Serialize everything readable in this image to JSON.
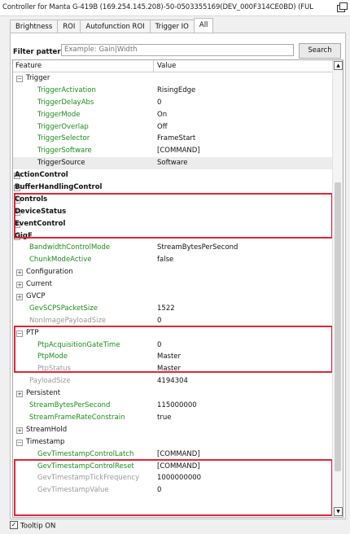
{
  "window": {
    "title": "Controller for Manta G-419B (169.254.145.208)-50-0503355169(DEV_000F314CE0BD) (FUL"
  },
  "tabs": [
    "Brightness",
    "ROI",
    "Autofunction ROI",
    "Trigger IO",
    "All"
  ],
  "filter": {
    "label": "Filter pattern:",
    "placeholder": "Example: Gain|Width",
    "search_label": "Search"
  },
  "table": {
    "col_feature": "Feature",
    "col_value": "Value"
  },
  "rows": [
    {
      "name": "Trigger",
      "value": "",
      "style": "",
      "exp": "-",
      "indent": 16
    },
    {
      "name": "TriggerActivation",
      "value": "RisingEdge",
      "style": "green",
      "indent": 30
    },
    {
      "name": "TriggerDelayAbs",
      "value": "0",
      "style": "green",
      "indent": 30
    },
    {
      "name": "TriggerMode",
      "value": "On",
      "style": "green",
      "indent": 30
    },
    {
      "name": "TriggerOverlap",
      "value": "Off",
      "style": "green",
      "indent": 30
    },
    {
      "name": "TriggerSelector",
      "value": "FrameStart",
      "style": "green",
      "indent": 30
    },
    {
      "name": "TriggerSoftware",
      "value": "[COMMAND]",
      "style": "green",
      "indent": 30
    },
    {
      "name": "TriggerSource",
      "value": "Software",
      "style": "",
      "indent": 30,
      "sel": true
    },
    {
      "name": "ActionControl",
      "value": "",
      "style": "bold",
      "exp": "+",
      "indent": 2
    },
    {
      "name": "BufferHandlingControl",
      "value": "",
      "style": "bold",
      "exp": "+",
      "indent": 2
    },
    {
      "name": "Controls",
      "value": "",
      "style": "bold",
      "exp": "+",
      "indent": 2
    },
    {
      "name": "DeviceStatus",
      "value": "",
      "style": "bold",
      "exp": "+",
      "indent": 2
    },
    {
      "name": "EventControl",
      "value": "",
      "style": "bold",
      "exp": "+",
      "indent": 2
    },
    {
      "name": "GigE",
      "value": "",
      "style": "bold",
      "exp": "-",
      "indent": 2
    },
    {
      "name": "BandwidthControlMode",
      "value": "StreamBytesPerSecond",
      "style": "green",
      "indent": 20
    },
    {
      "name": "ChunkModeActive",
      "value": "false",
      "style": "green",
      "indent": 20
    },
    {
      "name": "Configuration",
      "value": "",
      "style": "",
      "exp": "+",
      "indent": 16
    },
    {
      "name": "Current",
      "value": "",
      "style": "",
      "exp": "+",
      "indent": 16
    },
    {
      "name": "GVCP",
      "value": "",
      "style": "",
      "exp": "+",
      "indent": 16
    },
    {
      "name": "GevSCPSPacketSize",
      "value": "1522",
      "style": "green",
      "indent": 20
    },
    {
      "name": "NonImagePayloadSize",
      "value": "0",
      "style": "gray",
      "indent": 20
    },
    {
      "name": "PTP",
      "value": "",
      "style": "",
      "exp": "-",
      "indent": 16
    },
    {
      "name": "PtpAcquisitionGateTime",
      "value": "0",
      "style": "green",
      "indent": 30
    },
    {
      "name": "PtpMode",
      "value": "Master",
      "style": "green",
      "indent": 30
    },
    {
      "name": "PtpStatus",
      "value": "Master",
      "style": "gray",
      "indent": 30
    },
    {
      "name": "PayloadSize",
      "value": "4194304",
      "style": "gray",
      "indent": 20
    },
    {
      "name": "Persistent",
      "value": "",
      "style": "",
      "exp": "+",
      "indent": 16
    },
    {
      "name": "StreamBytesPerSecond",
      "value": "115000000",
      "style": "green",
      "indent": 20
    },
    {
      "name": "StreamFrameRateConstrain",
      "value": "true",
      "style": "green",
      "indent": 20
    },
    {
      "name": "StreamHold",
      "value": "",
      "style": "",
      "exp": "+",
      "indent": 16
    },
    {
      "name": "Timestamp",
      "value": "",
      "style": "",
      "exp": "-",
      "indent": 16
    },
    {
      "name": "GevTimestampControlLatch",
      "value": "[COMMAND]",
      "style": "green",
      "indent": 30
    },
    {
      "name": "GevTimestampControlReset",
      "value": "[COMMAND]",
      "style": "green",
      "indent": 30
    },
    {
      "name": "GevTimestampTickFrequency",
      "value": "1000000000",
      "style": "gray",
      "indent": 30
    },
    {
      "name": "GevTimestampValue",
      "value": "0",
      "style": "gray",
      "indent": 30
    }
  ],
  "tooltip": {
    "label": "Tooltip ON",
    "checked": true
  },
  "colors": {
    "highlight": "#d9273c",
    "feature_green": "#1f8a1f",
    "feature_gray": "#999999"
  }
}
